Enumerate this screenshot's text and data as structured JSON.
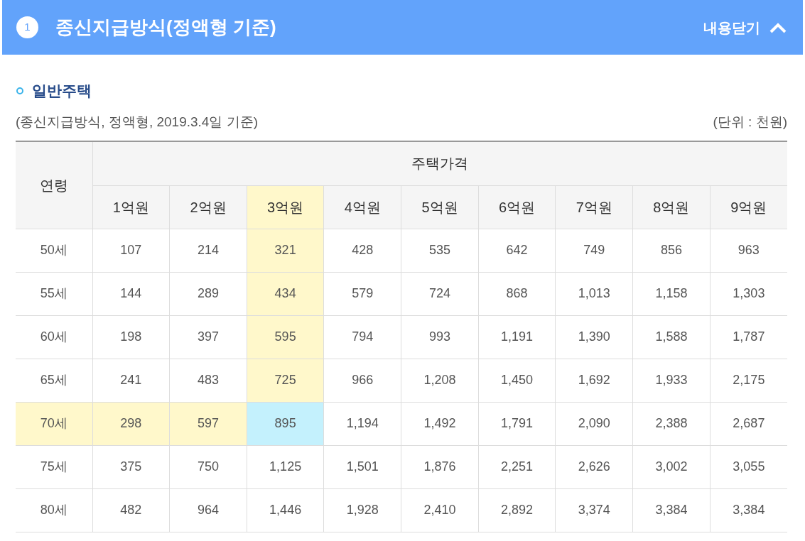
{
  "section_header": {
    "number": "1",
    "title": "종신지급방식(정액형 기준)",
    "toggle_label": "내용닫기",
    "expanded": true
  },
  "subsection": {
    "title": "일반주택"
  },
  "table_caption": "(종신지급방식, 정액형, 2019.3.4일 기준)",
  "unit_note": "(단위 : 천원)",
  "table": {
    "row_header": "연령",
    "group_header": "주택가격",
    "columns": [
      {
        "label": "1억원",
        "selected": false
      },
      {
        "label": "2억원",
        "selected": false
      },
      {
        "label": "3억원",
        "selected": true
      },
      {
        "label": "4억원",
        "selected": false
      },
      {
        "label": "5억원",
        "selected": false
      },
      {
        "label": "6억원",
        "selected": false
      },
      {
        "label": "7억원",
        "selected": false
      },
      {
        "label": "8억원",
        "selected": false
      },
      {
        "label": "9억원",
        "selected": false
      }
    ],
    "rows": [
      {
        "age": "50세",
        "selected": false,
        "values": [
          "107",
          "214",
          "321",
          "428",
          "535",
          "642",
          "749",
          "856",
          "963"
        ]
      },
      {
        "age": "55세",
        "selected": false,
        "values": [
          "144",
          "289",
          "434",
          "579",
          "724",
          "868",
          "1,013",
          "1,158",
          "1,303"
        ]
      },
      {
        "age": "60세",
        "selected": false,
        "values": [
          "198",
          "397",
          "595",
          "794",
          "993",
          "1,191",
          "1,390",
          "1,588",
          "1,787"
        ]
      },
      {
        "age": "65세",
        "selected": false,
        "values": [
          "241",
          "483",
          "725",
          "966",
          "1,208",
          "1,450",
          "1,692",
          "1,933",
          "2,175"
        ]
      },
      {
        "age": "70세",
        "selected": true,
        "values": [
          "298",
          "597",
          "895",
          "1,194",
          "1,492",
          "1,791",
          "2,090",
          "2,388",
          "2,687"
        ]
      },
      {
        "age": "75세",
        "selected": false,
        "values": [
          "375",
          "750",
          "1,125",
          "1,501",
          "1,876",
          "2,251",
          "2,626",
          "3,002",
          "3,055"
        ]
      },
      {
        "age": "80세",
        "selected": false,
        "values": [
          "482",
          "964",
          "1,446",
          "1,928",
          "2,410",
          "2,892",
          "3,374",
          "3,384",
          "3,384"
        ]
      }
    ]
  }
}
